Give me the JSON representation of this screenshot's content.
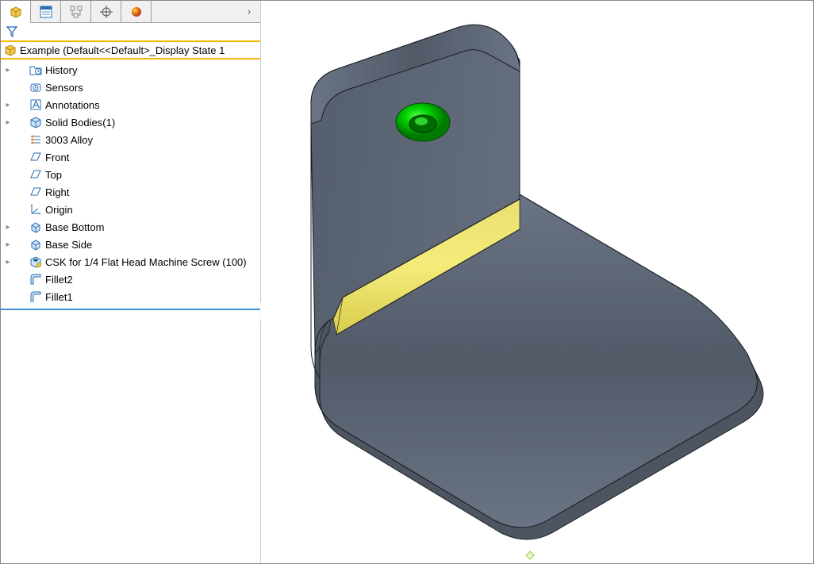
{
  "rootLabel": "Example  (Default<<Default>_Display State 1",
  "tree": [
    {
      "expander": "▸",
      "icon": "folder-history-icon",
      "label": "History"
    },
    {
      "expander": "",
      "icon": "sensors-icon",
      "label": "Sensors"
    },
    {
      "expander": "▸",
      "icon": "annotations-icon",
      "label": "Annotations"
    },
    {
      "expander": "▸",
      "icon": "solid-bodies-icon",
      "label": "Solid Bodies(1)"
    },
    {
      "expander": "",
      "icon": "material-icon",
      "label": "3003 Alloy"
    },
    {
      "expander": "",
      "icon": "plane-icon",
      "label": "Front"
    },
    {
      "expander": "",
      "icon": "plane-icon",
      "label": "Top"
    },
    {
      "expander": "",
      "icon": "plane-icon",
      "label": "Right"
    },
    {
      "expander": "",
      "icon": "origin-icon",
      "label": "Origin"
    },
    {
      "expander": "▸",
      "icon": "extrude-icon",
      "label": "Base Bottom"
    },
    {
      "expander": "▸",
      "icon": "extrude-icon",
      "label": "Base Side"
    },
    {
      "expander": "▸",
      "icon": "hole-icon",
      "label": "CSK for 1/4 Flat Head Machine Screw (100)"
    },
    {
      "expander": "",
      "icon": "fillet-icon",
      "label": "Fillet2"
    },
    {
      "expander": "",
      "icon": "fillet-icon",
      "label": "Fillet1"
    }
  ],
  "colors": {
    "partBody": "#616b79",
    "partEdge": "#1a1d22",
    "highlightYellow": "#f3e96b",
    "highlightGreen": "#00d400",
    "highlightGreenDark": "#009a00"
  }
}
